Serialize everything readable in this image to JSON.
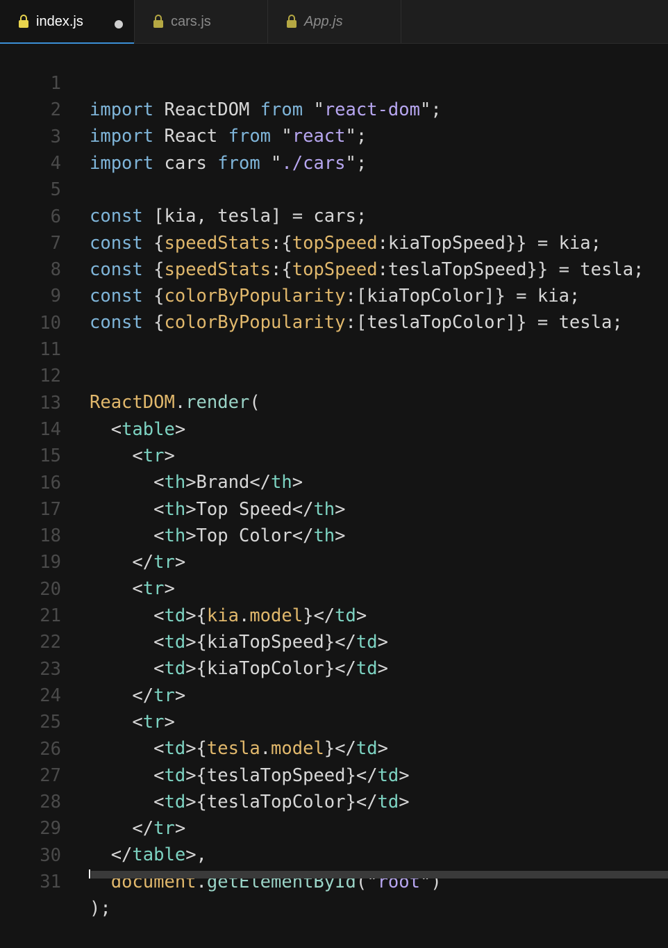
{
  "tabs": [
    {
      "label": "index.js",
      "active": true,
      "modified": true,
      "icon": "lock-icon"
    },
    {
      "label": "cars.js",
      "active": false,
      "modified": false,
      "icon": "lock-icon"
    },
    {
      "label": "App.js",
      "active": false,
      "modified": false,
      "icon": "lock-icon",
      "italic": true
    }
  ],
  "line_numbers": [
    "1",
    "2",
    "3",
    "4",
    "5",
    "6",
    "7",
    "8",
    "9",
    "10",
    "11",
    "12",
    "13",
    "14",
    "15",
    "16",
    "17",
    "18",
    "19",
    "20",
    "21",
    "22",
    "23",
    "24",
    "25",
    "26",
    "27",
    "28",
    "29",
    "30",
    "31"
  ],
  "code": {
    "l1": {
      "t1": "import",
      "t2": "ReactDOM",
      "t3": "from",
      "t4": "react-dom"
    },
    "l2": {
      "t1": "import",
      "t2": "React",
      "t3": "from",
      "t4": "react"
    },
    "l3": {
      "t1": "import",
      "t2": "cars",
      "t3": "from",
      "t4": "./cars"
    },
    "l5": {
      "t1": "const",
      "t2": "[kia, tesla] = cars;"
    },
    "l6": {
      "t1": "const",
      "t2": "speedStats",
      "t3": "topSpeed",
      "t4": "kiaTopSpeed",
      "t5": "kia"
    },
    "l7": {
      "t1": "const",
      "t2": "speedStats",
      "t3": "topSpeed",
      "t4": "teslaTopSpeed",
      "t5": "tesla"
    },
    "l8": {
      "t1": "const",
      "t2": "colorByPopularity",
      "t3": "kiaTopColor",
      "t4": "kia"
    },
    "l9": {
      "t1": "const",
      "t2": "colorByPopularity",
      "t3": "teslaTopColor",
      "t4": "tesla"
    },
    "l12": {
      "t1": "ReactDOM",
      "t2": "render"
    },
    "l13": {
      "tag": "table"
    },
    "l14": {
      "tag": "tr"
    },
    "l15": {
      "tag": "th",
      "text": "Brand"
    },
    "l16": {
      "tag": "th",
      "text": "Top Speed"
    },
    "l17": {
      "tag": "th",
      "text": "Top Color"
    },
    "l18": {
      "tag": "tr"
    },
    "l19": {
      "tag": "tr"
    },
    "l20": {
      "tag": "td",
      "obj": "kia",
      "prop": "model"
    },
    "l21": {
      "tag": "td",
      "text": "kiaTopSpeed"
    },
    "l22": {
      "tag": "td",
      "text": "kiaTopColor"
    },
    "l23": {
      "tag": "tr"
    },
    "l24": {
      "tag": "tr"
    },
    "l25": {
      "tag": "td",
      "obj": "tesla",
      "prop": "model"
    },
    "l26": {
      "tag": "td",
      "text": "teslaTopSpeed"
    },
    "l27": {
      "tag": "td",
      "text": "teslaTopColor"
    },
    "l28": {
      "tag": "tr"
    },
    "l29": {
      "tag": "table"
    },
    "l30": {
      "t1": "document",
      "t2": "getElementById",
      "t3": "root"
    },
    "l31": {
      "text": ");"
    }
  },
  "colors": {
    "background": "#141414",
    "keyword": "#7fb5d9",
    "string": "#b7a6f0",
    "property": "#e1b86c",
    "tag": "#7dd3c2",
    "active_tab_indicator": "#3b8fd6"
  }
}
